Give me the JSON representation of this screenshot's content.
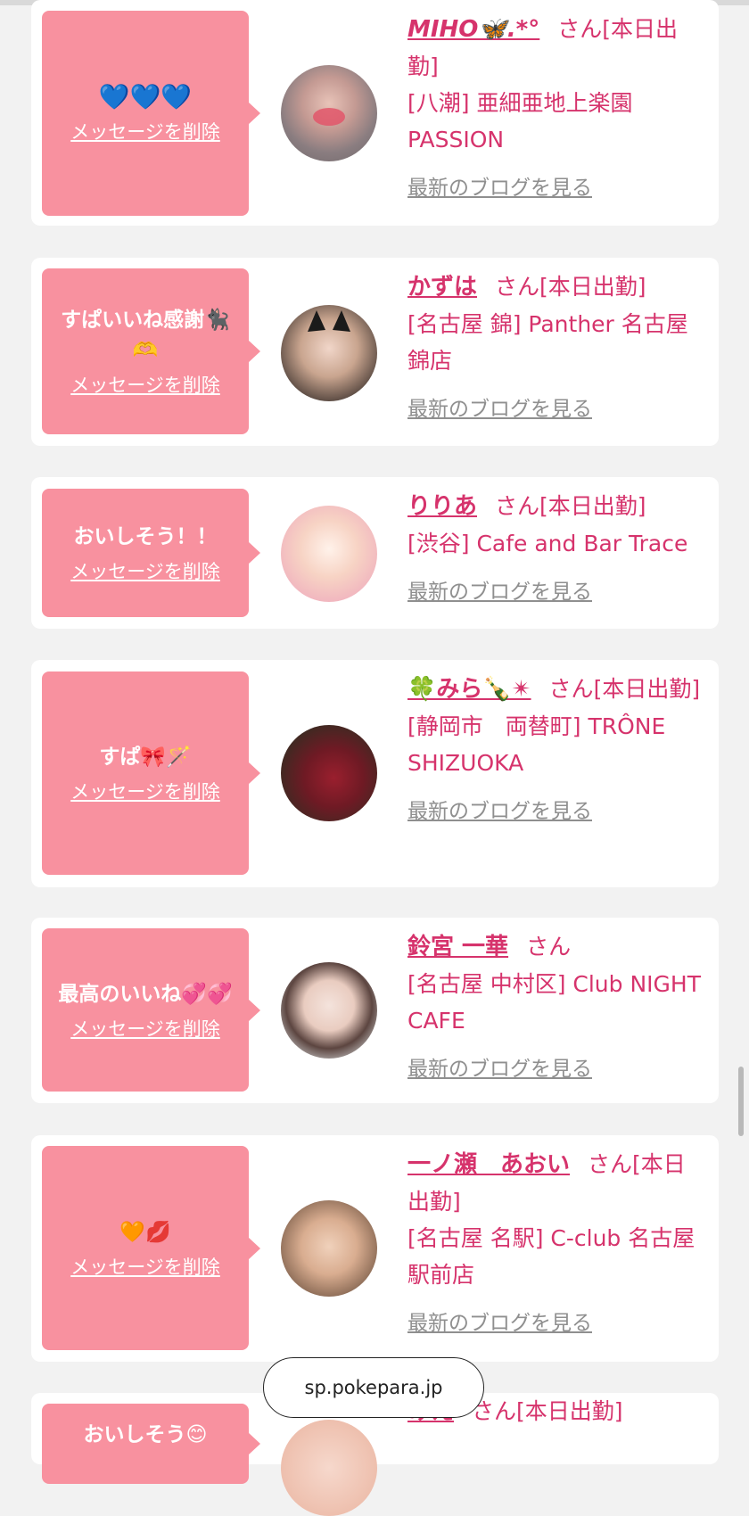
{
  "colors": {
    "accent": "#d6336c",
    "bubble": "#f8919f",
    "link_gray": "#8f8f8f"
  },
  "common": {
    "delete_label": "メッセージを削除",
    "blog_label": "最新のブログを見る",
    "san": "さん"
  },
  "cards": [
    {
      "message": "💙💙💙",
      "name": "MIHO🦋.*°",
      "status": "[本日出勤]",
      "shop": "[八潮] 亜細亜地上楽園 PASSION"
    },
    {
      "message": "すぱいいね感謝🐈‍⬛🫶",
      "name": "かずは",
      "status": "[本日出勤]",
      "shop": "[名古屋 錦] Panther 名古屋錦店"
    },
    {
      "message": "おいしそう！！",
      "name": "りりあ",
      "status": "[本日出勤]",
      "shop": "[渋谷] Cafe and Bar Trace"
    },
    {
      "message": "すぱ🎀🪄",
      "name": "🍀みら🍾✴",
      "status": "[本日出勤]",
      "shop": "[静岡市　両替町] TRÔNE SHIZUOKA"
    },
    {
      "message": "最高のいいね💞💞",
      "name": "鈴宮 一華",
      "status": "",
      "shop": "[名古屋 中村区] Club NIGHT CAFE"
    },
    {
      "message": "🧡💋",
      "name": "一ノ瀬　あおい",
      "status": "[本日出勤]",
      "shop": "[名古屋 名駅] C-club 名古屋駅前店"
    },
    {
      "message": "おいしそう😊",
      "name": "みえ",
      "status": "[本日出勤]",
      "shop": ""
    }
  ],
  "browser": {
    "url": "sp.pokepara.jp"
  }
}
